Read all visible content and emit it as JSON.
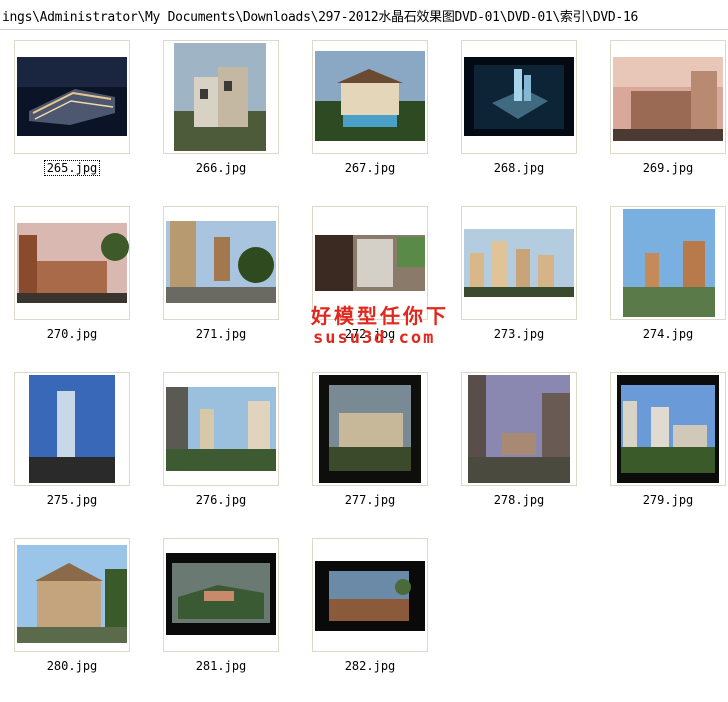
{
  "address_bar": {
    "path": "ings\\Administrator\\My Documents\\Downloads\\297-2012水晶石效果图DVD-01\\DVD-01\\索引\\DVD-16"
  },
  "files": [
    {
      "label": "265.jpg",
      "selected": true
    },
    {
      "label": "266.jpg"
    },
    {
      "label": "267.jpg"
    },
    {
      "label": "268.jpg"
    },
    {
      "label": "269.jpg"
    },
    {
      "label": "270.jpg"
    },
    {
      "label": "271.jpg"
    },
    {
      "label": "272.jpg"
    },
    {
      "label": "273.jpg"
    },
    {
      "label": "274.jpg"
    },
    {
      "label": "275.jpg"
    },
    {
      "label": "276.jpg"
    },
    {
      "label": "277.jpg"
    },
    {
      "label": "278.jpg"
    },
    {
      "label": "279.jpg"
    },
    {
      "label": "280.jpg"
    },
    {
      "label": "281.jpg"
    },
    {
      "label": "282.jpg"
    }
  ],
  "watermark": {
    "line1": "好模型任你下",
    "line2": "susu3d.com"
  },
  "colors": {
    "frame_border": "#ddd8c8",
    "watermark": "#e0281e"
  }
}
